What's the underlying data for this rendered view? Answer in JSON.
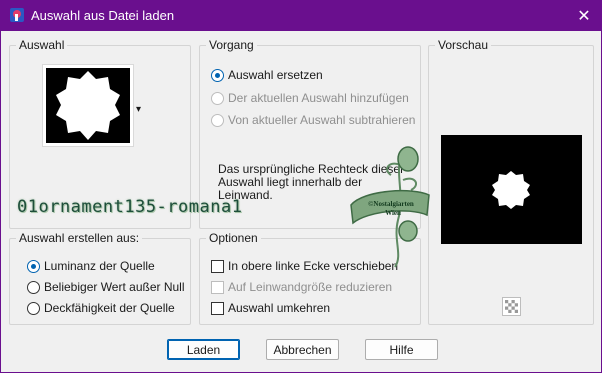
{
  "window": {
    "title": "Auswahl aus Datei laden",
    "close_glyph": "✕"
  },
  "auswahl_group": {
    "label": "Auswahl",
    "dropdown_glyph": "▾"
  },
  "vorgang_group": {
    "label": "Vorgang",
    "options": [
      {
        "label": "Auswahl ersetzen",
        "checked": true,
        "enabled": true
      },
      {
        "label": "Der aktuellen Auswahl hinzufügen",
        "checked": false,
        "enabled": false
      },
      {
        "label": "Von aktueller Auswahl subtrahieren",
        "checked": false,
        "enabled": false
      }
    ],
    "info_text_1": "Das ursprüngliche Rechteck dieser",
    "info_text_2": "Auswahl liegt innerhalb der",
    "info_text_3": "Leinwand."
  },
  "vorschau_group": {
    "label": "Vorschau",
    "toggle_icon": "checker-icon"
  },
  "erstellen_group": {
    "label": "Auswahl erstellen aus:",
    "options": [
      {
        "label": "Luminanz der Quelle",
        "checked": true
      },
      {
        "label": "Beliebiger Wert außer Null",
        "checked": false
      },
      {
        "label": "Deckfähigkeit der Quelle",
        "checked": false
      }
    ]
  },
  "optionen_group": {
    "label": "Optionen",
    "options": [
      {
        "label": "In obere linke Ecke verschieben",
        "checked": false,
        "enabled": true
      },
      {
        "label": "Auf Leinwandgröße reduzieren",
        "checked": false,
        "enabled": false
      },
      {
        "label": "Auswahl umkehren",
        "checked": false,
        "enabled": true
      }
    ]
  },
  "buttons": {
    "load": "Laden",
    "cancel": "Abbrechen",
    "help": "Hilfe"
  },
  "watermark": {
    "name": "01ornament135-romana1",
    "stamp_line1": "©Nostalgiarten",
    "stamp_line2": "Wien"
  },
  "colors": {
    "titlebar": "#6a0f8e",
    "accent": "#0063b1"
  }
}
